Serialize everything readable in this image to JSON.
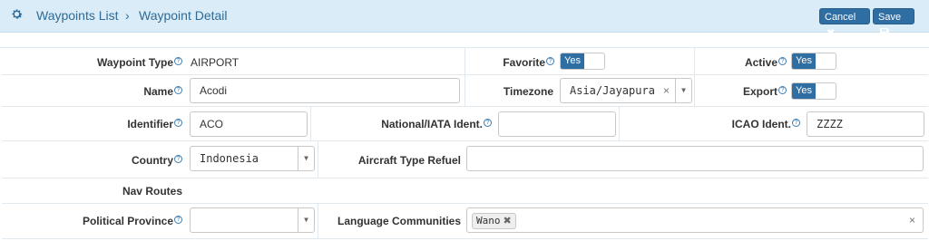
{
  "header": {
    "crumb_parent": "Waypoints List",
    "crumb_sep": "›",
    "crumb_current": "Waypoint Detail",
    "cancel_label": "Cancel",
    "cancel_icon": "✖",
    "save_label": "Save",
    "save_icon": "🖫",
    "settings_icon": "gear-icon"
  },
  "help_glyph": "?",
  "fields": {
    "waypoint_type": {
      "label": "Waypoint Type",
      "value": "AIRPORT"
    },
    "favorite": {
      "label": "Favorite",
      "value": "Yes"
    },
    "active": {
      "label": "Active",
      "value": "Yes"
    },
    "name": {
      "label": "Name",
      "value": "Acodi"
    },
    "timezone": {
      "label": "Timezone",
      "value": "Asia/Jayapura",
      "clear": "×"
    },
    "export": {
      "label": "Export",
      "value": "Yes"
    },
    "identifier": {
      "label": "Identifier",
      "value": "ACO"
    },
    "national_iata": {
      "label": "National/IATA Ident.",
      "value": ""
    },
    "icao": {
      "label": "ICAO Ident.",
      "value": "ZZZZ"
    },
    "country": {
      "label": "Country",
      "value": "Indonesia"
    },
    "aircraft_type_refuel": {
      "label": "Aircraft Type Refuel",
      "value": ""
    },
    "nav_routes": {
      "label": "Nav Routes"
    },
    "political_province": {
      "label": "Political Province",
      "value": ""
    },
    "language_communities": {
      "label": "Language Communities",
      "tags": [
        "Wano"
      ],
      "clear": "×"
    }
  },
  "colors": {
    "accent": "#2f6ea2",
    "header_bg": "#d9ecf7",
    "link": "#2f6b96"
  }
}
